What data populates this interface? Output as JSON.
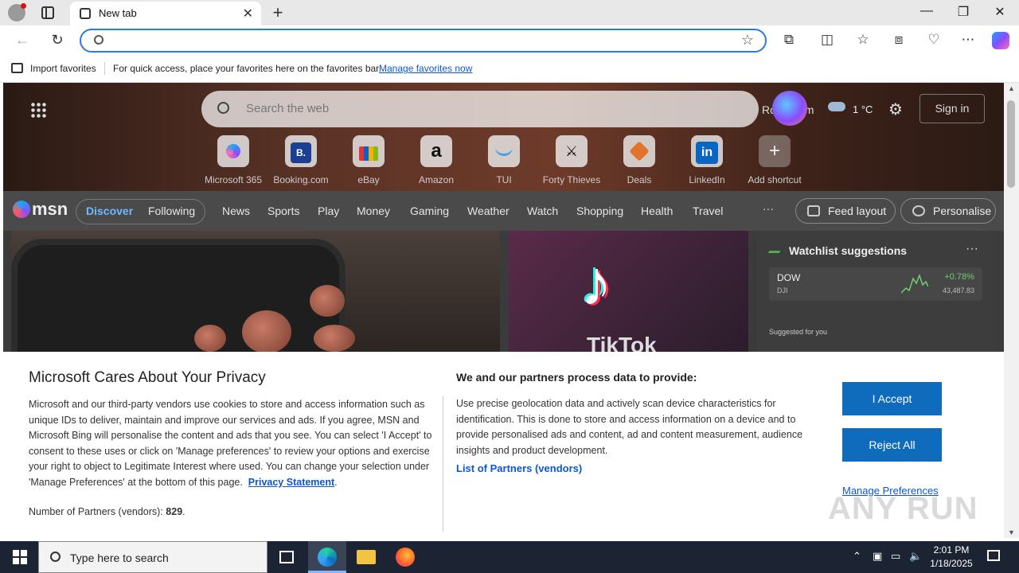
{
  "tab": {
    "title": "New tab"
  },
  "favbar": {
    "import_label": "Import favorites",
    "hint": "For quick access, place your favorites here on the favorites bar.",
    "manage_link": "Manage favorites now"
  },
  "hero": {
    "search_placeholder": "Search the web",
    "location": "Rotterdam",
    "temperature": "1 °C",
    "signin": "Sign in",
    "shortcuts": [
      {
        "label": "Microsoft 365",
        "icon": "m365-icon"
      },
      {
        "label": "Booking.com",
        "icon": "booking-icon",
        "glyph": "B."
      },
      {
        "label": "eBay",
        "icon": "ebay-icon"
      },
      {
        "label": "Amazon",
        "icon": "amazon-icon",
        "glyph": "a"
      },
      {
        "label": "TUI",
        "icon": "tui-icon"
      },
      {
        "label": "Forty Thieves",
        "icon": "swords-icon",
        "glyph": "⚔"
      },
      {
        "label": "Deals",
        "icon": "tag-icon"
      },
      {
        "label": "LinkedIn",
        "icon": "linkedin-icon",
        "glyph": "in"
      },
      {
        "label": "Add shortcut",
        "icon": "plus-icon",
        "glyph": "+"
      }
    ]
  },
  "msn": {
    "logo": "msn",
    "tabs": [
      "Discover",
      "Following"
    ],
    "nav": [
      "News",
      "Sports",
      "Play",
      "Money",
      "Gaming",
      "Weather",
      "Watch",
      "Shopping",
      "Health",
      "Travel"
    ],
    "more": "···",
    "feed_layout": "Feed layout",
    "personalise": "Personalise"
  },
  "cards": {
    "tiktok_text": "TikTok"
  },
  "watchlist": {
    "title": "Watchlist suggestions",
    "more": "···",
    "stock": {
      "symbol": "DOW",
      "name": "DJI",
      "change": "+0.78%",
      "price": "43,487.83"
    },
    "suggested": "Suggested for you"
  },
  "privacy": {
    "title": "Microsoft Cares About Your Privacy",
    "body": "Microsoft and our third-party vendors use cookies to store and access information such as unique IDs to deliver, maintain and improve our services and ads. If you agree, MSN and Microsoft Bing will personalise the content and ads that you see. You can select 'I Accept' to consent to these uses or click on 'Manage preferences' to review your options and exercise your right to object to Legitimate Interest where used.  You can change your selection under 'Manage Preferences' at the bottom of this page.",
    "privacy_link": "Privacy Statement",
    "partners_label": "Number of Partners (vendors):",
    "partners_count": "829",
    "heading2": "We and our partners process data to provide:",
    "body2": "Use precise geolocation data and actively scan device characteristics for identification. This is done to store and access information on a device and to provide personalised ads and content, ad and content measurement, audience insights and product development.",
    "partners_link": "List of Partners (vendors)",
    "accept": "I Accept",
    "reject": "Reject All",
    "manage": "Manage Preferences",
    "watermark": "ANY RUN"
  },
  "taskbar": {
    "search_placeholder": "Type here to search",
    "time": "2:01 PM",
    "date": "1/18/2025"
  }
}
